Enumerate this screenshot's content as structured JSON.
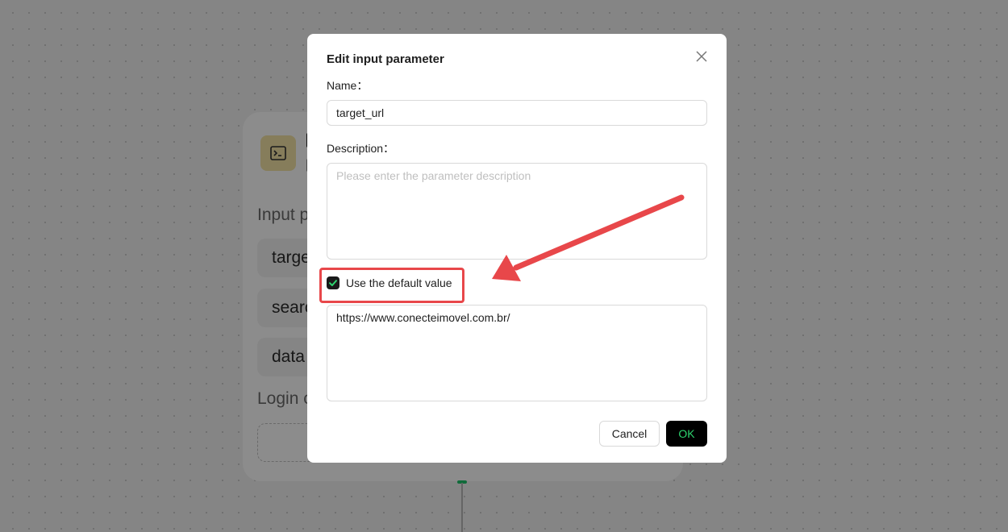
{
  "background_node": {
    "section_input": "Input p",
    "params": [
      "targe",
      "searc",
      "data"
    ],
    "section_login": "Login c"
  },
  "dialog": {
    "title": "Edit input parameter",
    "close_icon": "close-icon",
    "name_label": "Name：",
    "name_value": "target_url",
    "description_label": "Description：",
    "description_value": "",
    "description_placeholder": "Please enter the parameter description",
    "use_default_label": "Use the default value",
    "use_default_checked": true,
    "default_value": "https://www.conecteimovel.com.br/",
    "cancel_label": "Cancel",
    "ok_label": "OK"
  },
  "colors": {
    "ok_text": "#2ed46f",
    "annotation": "#e8474a",
    "node_icon_bg": "#f5e3a6"
  }
}
